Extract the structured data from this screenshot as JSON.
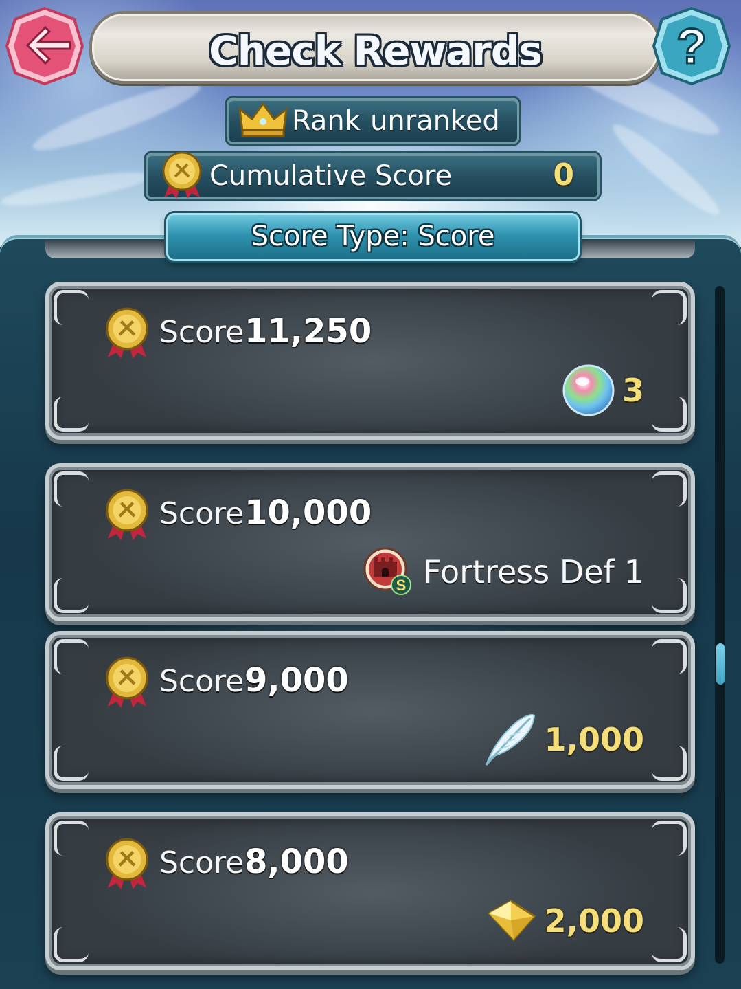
{
  "header": {
    "title": "Check Rewards",
    "back_icon": "back-arrow-icon",
    "help_icon": "help-question-icon"
  },
  "rank": {
    "icon": "crown-icon",
    "label": "Rank",
    "value": "unranked"
  },
  "cumulative": {
    "icon": "medal-icon",
    "label": "Cumulative Score",
    "value": "0"
  },
  "score_type": {
    "label": "Score Type: Score"
  },
  "rewards": [
    {
      "label": "Score",
      "score": "11,250",
      "reward_icon": "orb-icon",
      "reward_name": "",
      "reward_qty": "3"
    },
    {
      "label": "Score",
      "score": "10,000",
      "reward_icon": "fortress-seal-icon",
      "reward_name": "Fortress Def",
      "reward_qty": "1"
    },
    {
      "label": "Score",
      "score": "9,000",
      "reward_icon": "feather-icon",
      "reward_name": "",
      "reward_qty": "1,000"
    },
    {
      "label": "Score",
      "score": "8,000",
      "reward_icon": "crystal-icon",
      "reward_name": "",
      "reward_qty": "2,000"
    }
  ],
  "colors": {
    "accent_gold": "#f3de7a",
    "panel_teal": "#1f4a5c",
    "back_button_red": "#e05a7a",
    "help_button_teal": "#3aa6bf"
  }
}
